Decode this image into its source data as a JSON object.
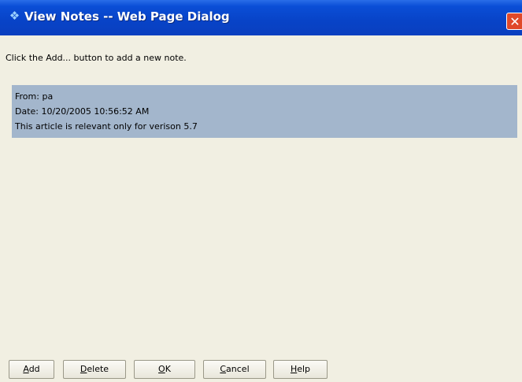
{
  "window": {
    "title": "View Notes -- Web Page Dialog",
    "title_icon": "ie-page-icon",
    "close_icon": "close-icon"
  },
  "instruction": "Click the Add... button to add a new note.",
  "note": {
    "from": "From: pa",
    "date": "Date: 10/20/2005 10:56:52 AM",
    "text": "This article is relevant only for verison 5.7"
  },
  "buttons": {
    "add": {
      "accel": "A",
      "rest": "dd"
    },
    "delete": {
      "accel": "D",
      "rest": "elete"
    },
    "ok": {
      "accel": "O",
      "rest": "K"
    },
    "cancel": {
      "accel": "C",
      "rest": "ancel"
    },
    "help": {
      "accel": "H",
      "rest": "elp"
    }
  },
  "colors": {
    "titlebar": "#0a4ed6",
    "note_background": "#a3b6cc",
    "dialog_background": "#f1efe2",
    "close_button": "#e0492a"
  }
}
